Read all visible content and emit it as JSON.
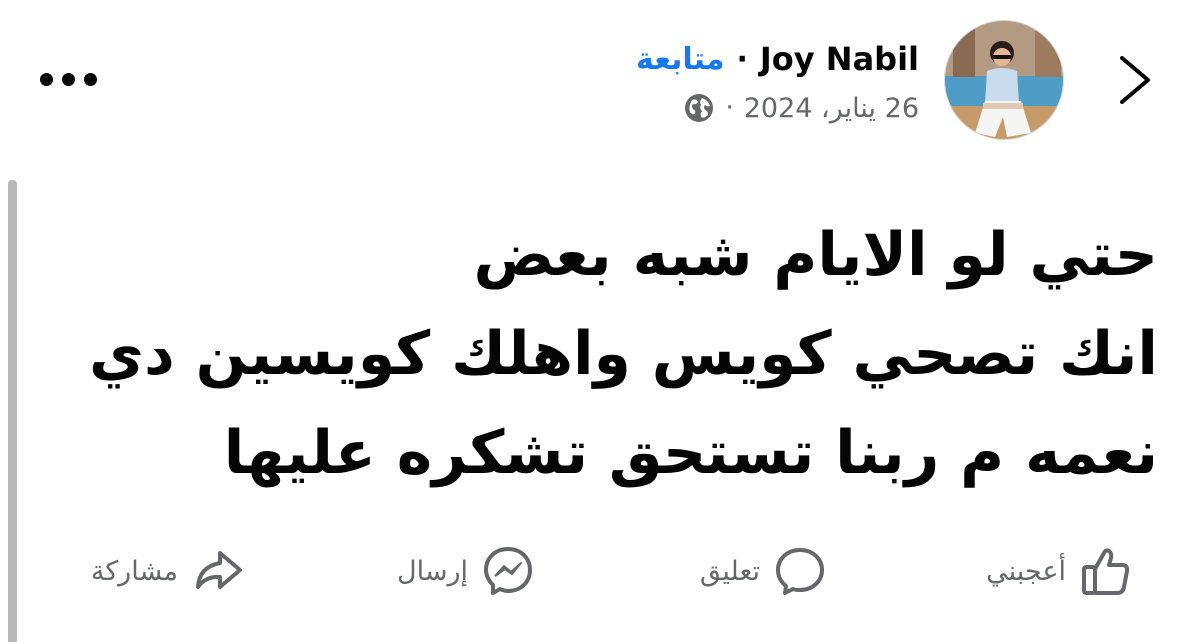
{
  "header": {
    "author_name": "Joy Nabil",
    "follow_label": "متابعة",
    "separator": "·",
    "date": "26 يناير، 2024",
    "privacy_icon": "globe-icon",
    "back_icon": "chevron-right-icon",
    "more_icon": "more-options-icon"
  },
  "post": {
    "lines": [
      "حتي لو الايام شبه بعض",
      "انك تصحي كويس واهلك كويسين دي",
      "نعمه م ربنا تستحق تشكره عليها"
    ]
  },
  "actions": {
    "like_label": "أعجبني",
    "comment_label": "تعليق",
    "send_label": "إرسال",
    "share_label": "مشاركة"
  },
  "colors": {
    "accent": "#1877f2",
    "text": "#050505",
    "secondary": "#65676b"
  }
}
